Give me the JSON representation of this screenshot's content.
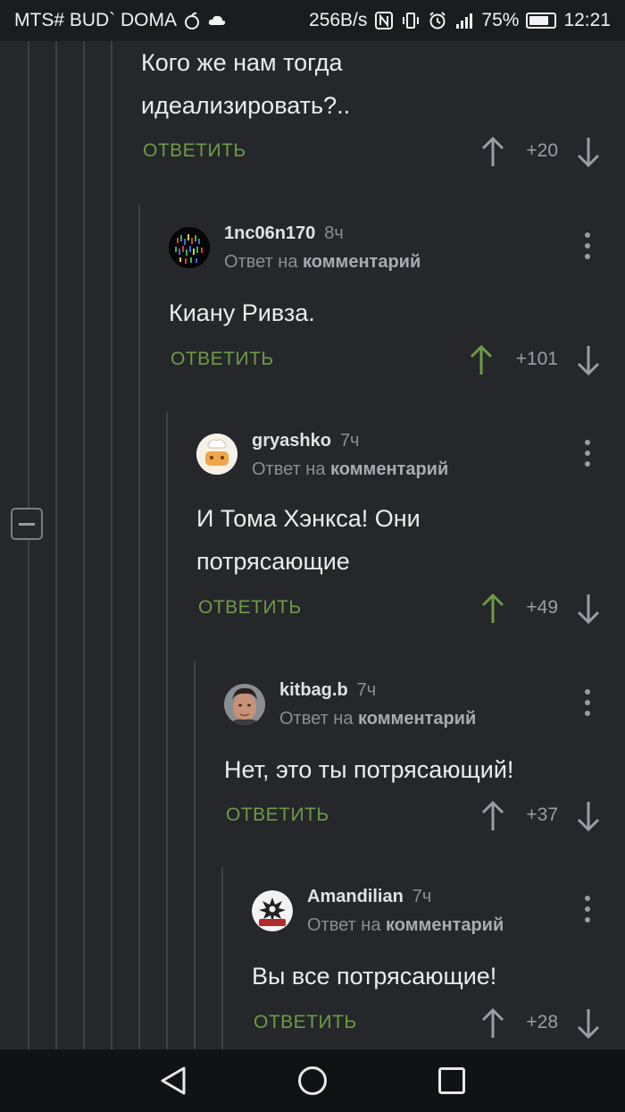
{
  "status_bar": {
    "carrier": "MTS# BUD` DOMA",
    "net_speed": "256B/s",
    "battery": "75%",
    "time": "12:21",
    "battery_level": 0.75
  },
  "collapse_label": "−",
  "top_comment": {
    "text": "Кого же нам тогда идеализировать?..",
    "reply_label": "ОТВЕТИТЬ",
    "score": "+20"
  },
  "comments": [
    {
      "author": "1nc06n170",
      "time": "8ч",
      "reply_prefix": "Ответ на",
      "reply_target": "комментарий",
      "text": "Киану Ривза.",
      "reply_label": "ОТВЕТИТЬ",
      "score": "+101",
      "upvoted": true
    },
    {
      "author": "gryashko",
      "time": "7ч",
      "reply_prefix": "Ответ на",
      "reply_target": "комментарий",
      "text": "И Тома Хэнкса! Они потрясающие",
      "reply_label": "ОТВЕТИТЬ",
      "score": "+49",
      "upvoted": true
    },
    {
      "author": "kitbag.b",
      "time": "7ч",
      "reply_prefix": "Ответ на",
      "reply_target": "комментарий",
      "text": "Нет, это ты потрясающий!",
      "reply_label": "ОТВЕТИТЬ",
      "score": "+37",
      "upvoted": false
    },
    {
      "author": "Amandilian",
      "time": "7ч",
      "reply_prefix": "Ответ на",
      "reply_target": "комментарий",
      "text": "Вы все потрясающие!",
      "reply_label": "ОТВЕТИТЬ",
      "score": "+28",
      "upvoted": false
    }
  ],
  "colors": {
    "background": "#25272b",
    "accent_green": "#6e9a47",
    "muted": "#8b8e93"
  }
}
